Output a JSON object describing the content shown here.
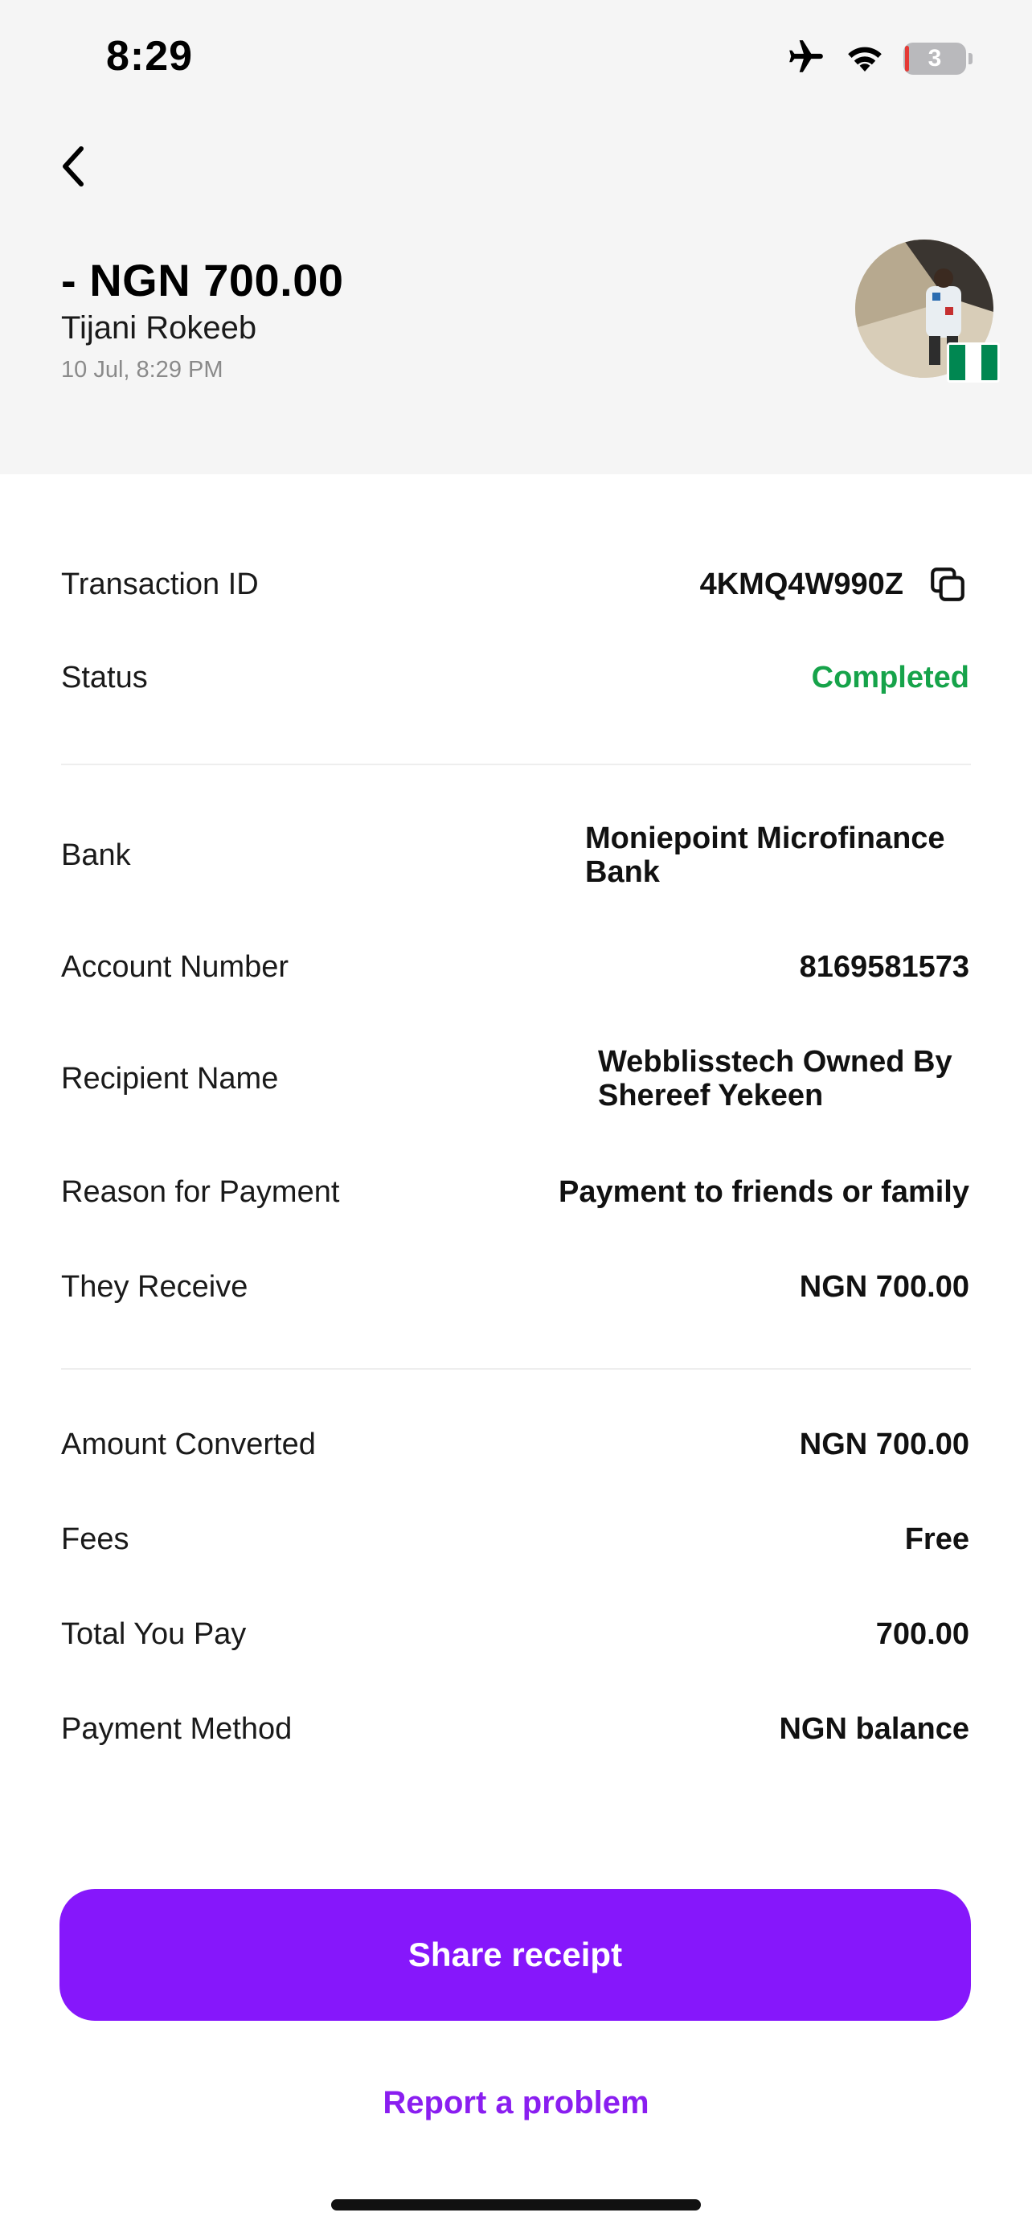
{
  "status_bar": {
    "time": "8:29",
    "battery_level": "3",
    "icons": [
      "airplane-icon",
      "wifi-icon",
      "battery-icon"
    ]
  },
  "header": {
    "amount": "- NGN 700.00",
    "recipient_name": "Tijani Rokeeb",
    "datetime": "10 Jul, 8:29 PM",
    "flag_colors": [
      "#008751",
      "#ffffff",
      "#008751"
    ]
  },
  "details": {
    "transaction_id": {
      "label": "Transaction ID",
      "value": "4KMQ4W990Z"
    },
    "status": {
      "label": "Status",
      "value": "Completed",
      "color": "#16a34a"
    },
    "bank": {
      "label": "Bank",
      "value_line1": "Moniepoint Microfinance",
      "value_line2": "Bank"
    },
    "account_number": {
      "label": "Account Number",
      "value": "8169581573"
    },
    "recipient_name": {
      "label": "Recipient Name",
      "value_line1": "Webblisstech Owned By",
      "value_line2": "Shereef Yekeen"
    },
    "reason": {
      "label": "Reason for Payment",
      "value": "Payment to friends or family"
    },
    "they_receive": {
      "label": "They Receive",
      "value": "NGN 700.00"
    },
    "amount_converted": {
      "label": "Amount Converted",
      "value": "NGN 700.00"
    },
    "fees": {
      "label": "Fees",
      "value": "Free"
    },
    "total_you_pay": {
      "label": "Total You Pay",
      "value": "700.00"
    },
    "payment_method": {
      "label": "Payment Method",
      "value": "NGN balance"
    }
  },
  "actions": {
    "share_label": "Share receipt",
    "report_label": "Report a problem",
    "accent_color": "#8617fb"
  }
}
